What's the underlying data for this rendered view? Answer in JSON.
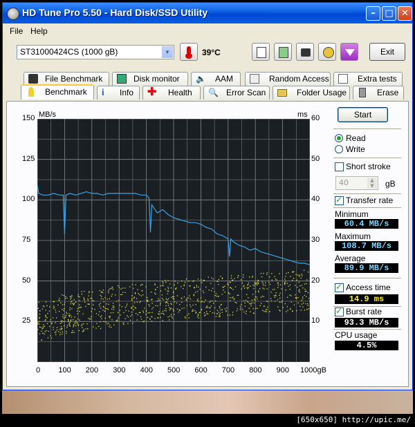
{
  "window": {
    "title": "HD Tune Pro 5.50 - Hard Disk/SSD Utility"
  },
  "menu": {
    "file": "File",
    "help": "Help"
  },
  "toolbar": {
    "drive": "ST31000424CS (1000 gB)",
    "temperature": "39°C",
    "exit": "Exit"
  },
  "tabs_top": [
    {
      "label": "File Benchmark"
    },
    {
      "label": "Disk monitor"
    },
    {
      "label": "AAM"
    },
    {
      "label": "Random Access"
    },
    {
      "label": "Extra tests"
    }
  ],
  "tabs_bottom": [
    {
      "label": "Benchmark"
    },
    {
      "label": "Info"
    },
    {
      "label": "Health"
    },
    {
      "label": "Error Scan"
    },
    {
      "label": "Folder Usage"
    },
    {
      "label": "Erase"
    }
  ],
  "controls": {
    "start": "Start",
    "read": "Read",
    "write": "Write",
    "short_stroke": "Short stroke",
    "stroke_value": "40",
    "stroke_unit": "gB",
    "transfer_rate": "Transfer rate",
    "access_time": "Access time",
    "burst_rate": "Burst rate",
    "cpu_usage": "CPU usage"
  },
  "results": {
    "min_label": "Minimum",
    "min": "60.4 MB/s",
    "max_label": "Maximum",
    "max": "108.7 MB/s",
    "avg_label": "Average",
    "avg": "89.9 MB/s",
    "access": "14.9 ms",
    "burst": "93.3 MB/s",
    "cpu": "4.5%"
  },
  "colors": {
    "transfer": "#3aa3e6",
    "access": "#e6e04a",
    "grid": "#8a8a8a",
    "bg": "#1a1f24"
  },
  "chart_data": {
    "type": "line",
    "y_left_label": "MB/s",
    "y_right_label": "ms",
    "x_ticks": [
      "0",
      "100",
      "200",
      "300",
      "400",
      "500",
      "600",
      "700",
      "800",
      "900",
      "1000gB"
    ],
    "y_left_ticks": [
      "150",
      "125",
      "100",
      "75",
      "50",
      "25"
    ],
    "y_right_ticks": [
      "60",
      "50",
      "40",
      "30",
      "20",
      "10"
    ],
    "x_range": [
      0,
      1000
    ],
    "y_left_range": [
      0,
      150
    ],
    "y_right_range": [
      0,
      60
    ],
    "transfer": {
      "x": [
        0,
        5,
        20,
        40,
        60,
        80,
        95,
        100,
        105,
        120,
        140,
        160,
        180,
        200,
        220,
        240,
        260,
        280,
        300,
        320,
        340,
        360,
        380,
        400,
        410,
        415,
        420,
        440,
        460,
        480,
        500,
        520,
        540,
        560,
        580,
        600,
        620,
        640,
        660,
        680,
        700,
        705,
        710,
        720,
        740,
        760,
        780,
        800,
        820,
        840,
        860,
        880,
        900,
        920,
        940,
        960,
        980,
        1000
      ],
      "y": [
        109,
        104,
        103,
        103,
        104,
        103,
        103,
        79,
        103,
        104,
        103,
        104,
        105,
        104,
        104,
        103,
        104,
        104,
        104,
        104,
        104,
        104,
        103,
        103,
        101,
        80,
        97,
        92,
        94,
        91,
        89,
        88,
        87,
        86,
        86,
        85,
        83,
        82,
        79,
        78,
        76,
        65,
        76,
        74,
        72,
        71,
        69,
        70,
        68,
        67,
        66,
        65,
        64,
        63,
        62,
        61,
        61,
        60
      ]
    },
    "access_trend_ms": {
      "x": [
        0,
        100,
        200,
        300,
        400,
        500,
        600,
        700,
        800,
        900,
        1000
      ],
      "y": [
        10,
        12,
        13,
        14,
        15,
        15.5,
        16,
        16.5,
        17,
        17.5,
        18
      ]
    }
  }
}
